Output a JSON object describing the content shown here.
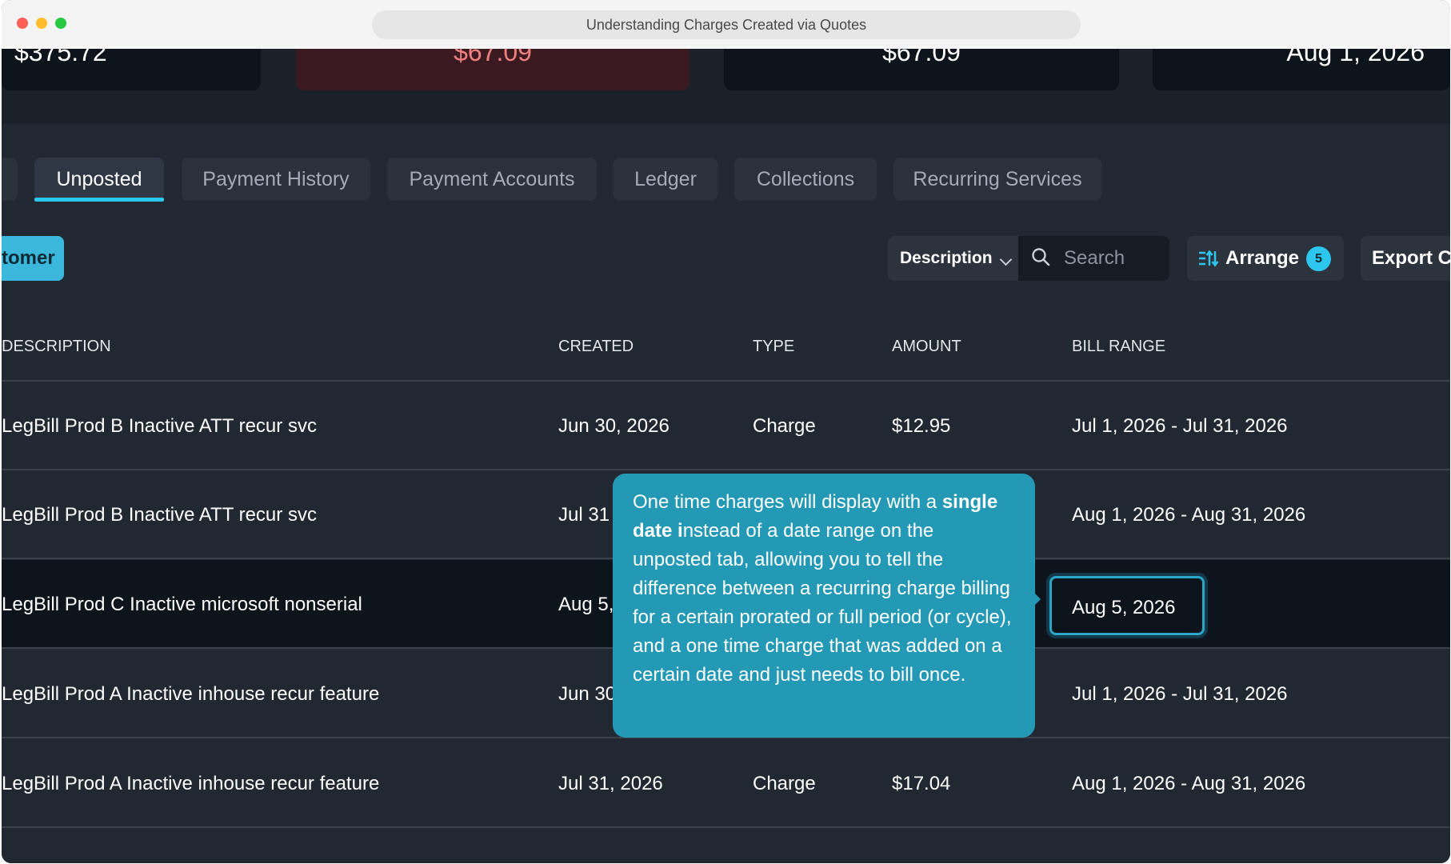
{
  "window": {
    "title": "Understanding Charges Created via Quotes"
  },
  "stats": [
    {
      "value": "$375.72"
    },
    {
      "value": "$67.09"
    },
    {
      "value": "$67.09"
    },
    {
      "value": "Aug 1, 2026"
    }
  ],
  "tabs": [
    {
      "label": "Unposted",
      "active": true
    },
    {
      "label": "Payment History"
    },
    {
      "label": "Payment Accounts"
    },
    {
      "label": "Ledger"
    },
    {
      "label": "Collections"
    },
    {
      "label": "Recurring Services"
    }
  ],
  "toolbar": {
    "customer_button": "tomer",
    "filter_select": "Description",
    "search_placeholder": "Search",
    "arrange_label": "Arrange",
    "arrange_count": "5",
    "export_label": "Export CS"
  },
  "table": {
    "columns": [
      "DESCRIPTION",
      "CREATED",
      "TYPE",
      "AMOUNT",
      "BILL RANGE"
    ],
    "rows": [
      {
        "description": "LegBill Prod B Inactive ATT recur svc",
        "created": "Jun 30, 2026",
        "type": "Charge",
        "amount": "$12.95",
        "bill_range": "Jul 1, 2026 - Jul 31, 2026"
      },
      {
        "description": "LegBill Prod B Inactive ATT recur svc",
        "created": "Jul 31",
        "type": "",
        "amount": "",
        "bill_range": "Aug 1, 2026 - Aug 31, 2026"
      },
      {
        "description": "LegBill Prod C Inactive microsoft nonserial",
        "created": "Aug 5,",
        "type": "",
        "amount": "",
        "bill_range": "Aug 5, 2026"
      },
      {
        "description": "LegBill Prod A Inactive inhouse recur feature",
        "created": "Jun 30",
        "type": "",
        "amount": "",
        "bill_range": "Jul 1, 2026 - Jul 31, 2026"
      },
      {
        "description": "LegBill Prod A Inactive inhouse recur feature",
        "created": "Jul 31, 2026",
        "type": "Charge",
        "amount": "$17.04",
        "bill_range": "Aug 1, 2026 - Aug 31, 2026"
      }
    ]
  },
  "tooltip": {
    "text_before": "One time charges will display with a ",
    "text_bold": "single date i",
    "text_after": "nstead of a date range on the unposted tab, allowing you to tell the difference between a recurring charge billing for a certain prorated or full period (or cycle), and a one time charge that was added on a certain date and just needs to bill once."
  },
  "colors": {
    "accent": "#2cc6ee",
    "tooltip": "#2499b6",
    "negative": "#f08080",
    "background": "#222831"
  }
}
